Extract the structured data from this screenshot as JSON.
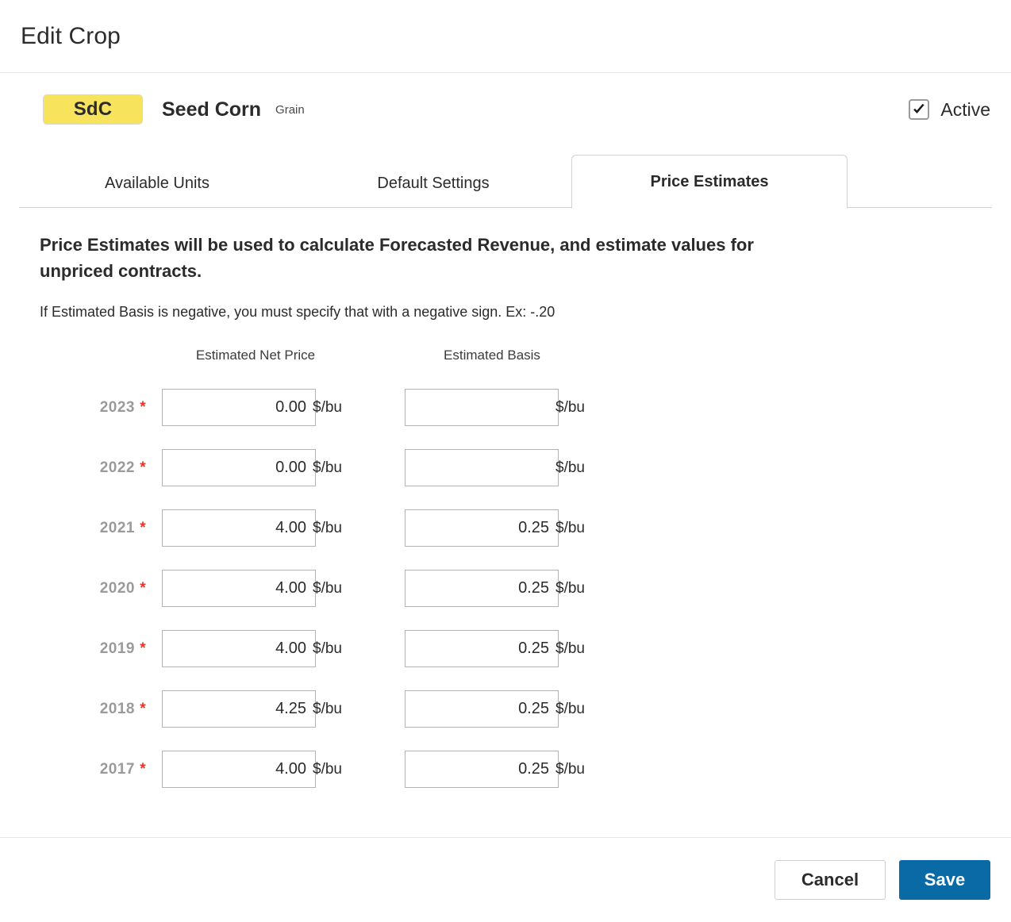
{
  "window": {
    "title": "Edit Crop"
  },
  "crop": {
    "badge": "SdC",
    "name": "Seed Corn",
    "type": "Grain",
    "active_label": "Active",
    "active_checked": true,
    "badge_color": "#f7e45c",
    "check_icon": "checkmark-icon"
  },
  "tabs": [
    {
      "label": "Available Units",
      "active": false
    },
    {
      "label": "Default Settings",
      "active": false
    },
    {
      "label": "Price Estimates",
      "active": true
    }
  ],
  "main": {
    "lead": "Price Estimates will be used to calculate Forecasted Revenue, and estimate values for unpriced contracts.",
    "subnote": "If Estimated Basis is negative, you must specify that with a negative sign. Ex: -.20",
    "columns": {
      "net_price": "Estimated Net Price",
      "basis": "Estimated Basis"
    },
    "unit": "$/bu",
    "required_marker": "*",
    "rows": [
      {
        "year": "2023",
        "net_price": "0.00",
        "basis": ""
      },
      {
        "year": "2022",
        "net_price": "0.00",
        "basis": ""
      },
      {
        "year": "2021",
        "net_price": "4.00",
        "basis": "0.25"
      },
      {
        "year": "2020",
        "net_price": "4.00",
        "basis": "0.25"
      },
      {
        "year": "2019",
        "net_price": "4.00",
        "basis": "0.25"
      },
      {
        "year": "2018",
        "net_price": "4.25",
        "basis": "0.25"
      },
      {
        "year": "2017",
        "net_price": "4.00",
        "basis": "0.25"
      }
    ]
  },
  "footer": {
    "cancel_label": "Cancel",
    "save_label": "Save",
    "save_color": "#0a6aa6"
  }
}
